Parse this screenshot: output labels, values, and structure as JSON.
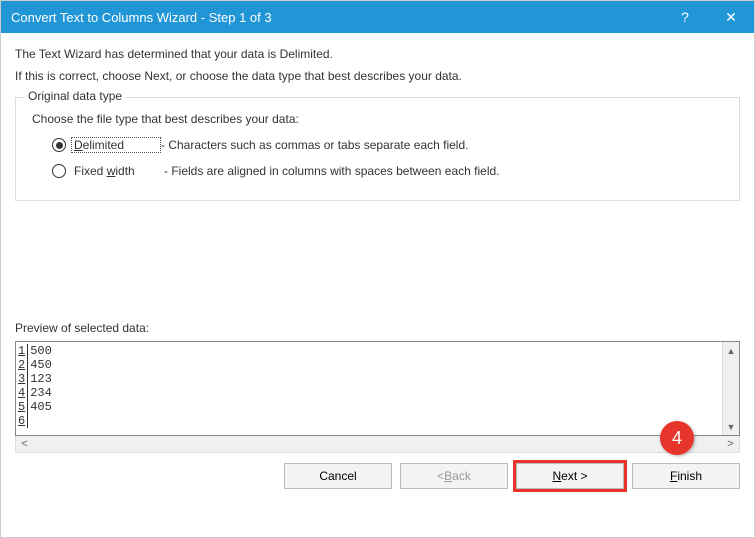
{
  "titlebar": {
    "title": "Convert Text to Columns Wizard - Step 1 of 3",
    "help": "?",
    "close": "✕"
  },
  "intro": {
    "line1": "The Text Wizard has determined that your data is Delimited.",
    "line2": "If this is correct, choose Next, or choose the data type that best describes your data."
  },
  "fieldset": {
    "legend": "Original data type",
    "desc": "Choose the file type that best describes your data:",
    "options": [
      {
        "label_pre": "",
        "label_accel": "D",
        "label_post": "elimited",
        "desc": "- Characters such as commas or tabs separate each field.",
        "checked": true
      },
      {
        "label_pre": "Fixed ",
        "label_accel": "w",
        "label_post": "idth",
        "desc": "- Fields are aligned in columns with spaces between each field.",
        "checked": false
      }
    ]
  },
  "preview": {
    "label": "Preview of selected data:",
    "rows": [
      {
        "n": "1",
        "v": "500"
      },
      {
        "n": "2",
        "v": "450"
      },
      {
        "n": "3",
        "v": "123"
      },
      {
        "n": "4",
        "v": "234"
      },
      {
        "n": "5",
        "v": "405"
      },
      {
        "n": "6",
        "v": ""
      }
    ]
  },
  "buttons": {
    "cancel": "Cancel",
    "back_pre": "< ",
    "back_accel": "B",
    "back_post": "ack",
    "next_accel": "N",
    "next_post": "ext >",
    "finish_accel": "F",
    "finish_post": "inish"
  },
  "callout": "4"
}
